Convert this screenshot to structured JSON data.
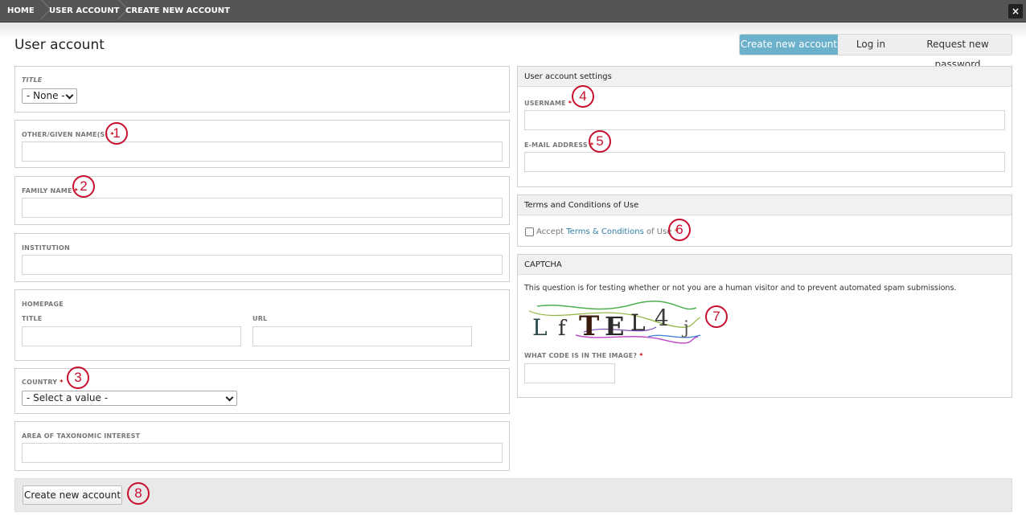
{
  "breadcrumb": [
    "HOME",
    "USER ACCOUNT",
    "CREATE NEW ACCOUNT"
  ],
  "close_icon": "×",
  "page_title": "User account",
  "tabs": [
    {
      "label": "Create new account",
      "active": true
    },
    {
      "label": "Log in",
      "active": false
    },
    {
      "label": "Request new password",
      "active": false
    }
  ],
  "left_form": {
    "title_label": "TITLE",
    "title_value": "- None -",
    "given_name_label": "OTHER/GIVEN NAME(S)",
    "family_name_label": "FAMILY NAME",
    "institution_label": "INSTITUTION",
    "homepage_label": "HOMEPAGE",
    "homepage_title_label": "TITLE",
    "homepage_url_label": "URL",
    "country_label": "COUNTRY",
    "country_value": "- Select a value -",
    "taxonomic_label": "AREA OF TAXONOMIC INTEREST",
    "required_mark": "*"
  },
  "account_settings": {
    "heading": "User account settings",
    "username_label": "USERNAME",
    "email_label": "E-MAIL ADDRESS"
  },
  "terms": {
    "heading": "Terms and Conditions of Use",
    "accept_prefix": "Accept ",
    "link_text": "Terms & Conditions",
    "accept_suffix": " of Use"
  },
  "captcha": {
    "heading": "CAPTCHA",
    "description": "This question is for testing whether or not you are a human visitor and to prevent automated spam submissions.",
    "image_chars": [
      "L",
      "f",
      "T",
      "E",
      "L",
      "4",
      "j"
    ],
    "code_label": "WHAT CODE IS IN THE IMAGE?"
  },
  "submit_label": "Create new account",
  "markers": [
    "1",
    "2",
    "3",
    "4",
    "5",
    "6",
    "7",
    "8"
  ],
  "colors": {
    "accent": "#6bb1cc",
    "marker": "#c8102e",
    "required": "#cc0000",
    "link": "#2f7fa3"
  }
}
